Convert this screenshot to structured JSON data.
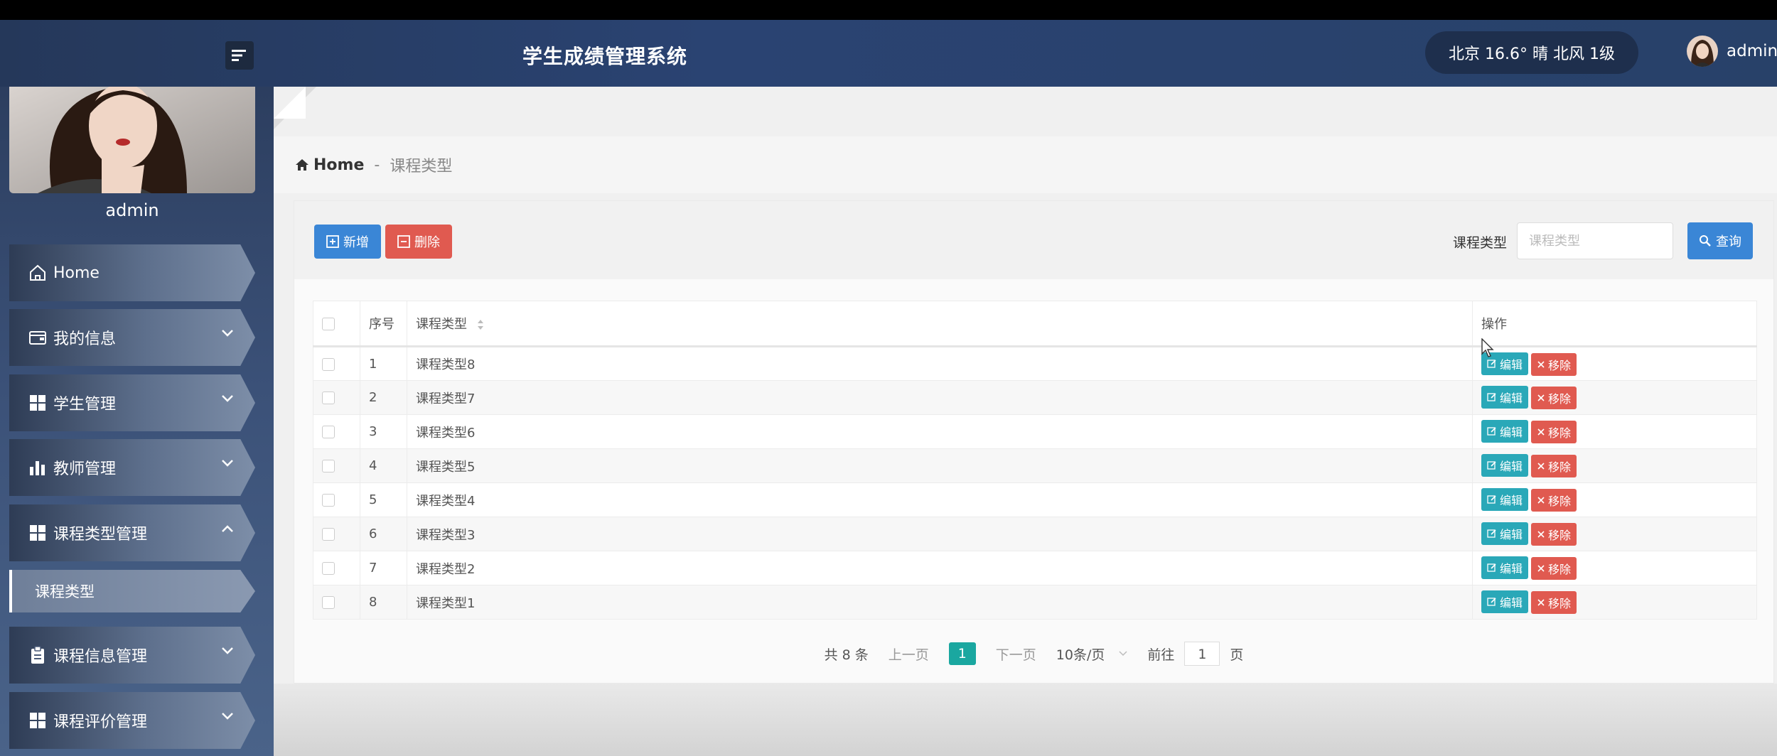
{
  "header": {
    "title": "学生成绩管理系统",
    "weather": "北京 16.6° 晴 北风 1级",
    "username": "admin"
  },
  "sidebar": {
    "profile_name": "admin",
    "items": [
      {
        "label": "Home",
        "icon": "home-icon"
      },
      {
        "label": "我的信息",
        "icon": "wallet-icon"
      },
      {
        "label": "学生管理",
        "icon": "grid-icon"
      },
      {
        "label": "教师管理",
        "icon": "bar-chart-icon"
      },
      {
        "label": "课程类型管理",
        "icon": "grid-icon"
      },
      {
        "label": "课程信息管理",
        "icon": "clipboard-icon"
      },
      {
        "label": "课程评价管理",
        "icon": "grid-icon"
      }
    ],
    "sub_item": "课程类型"
  },
  "breadcrumb": {
    "home": "Home",
    "sep": "-",
    "current": "课程类型"
  },
  "toolbar": {
    "add_label": "新增",
    "delete_label": "删除",
    "search_label": "课程类型",
    "search_placeholder": "课程类型",
    "query_label": "查询"
  },
  "table": {
    "headers": {
      "index": "序号",
      "type": "课程类型",
      "ops": "操作"
    },
    "rows": [
      {
        "index": "1",
        "type": "课程类型8"
      },
      {
        "index": "2",
        "type": "课程类型7"
      },
      {
        "index": "3",
        "type": "课程类型6"
      },
      {
        "index": "4",
        "type": "课程类型5"
      },
      {
        "index": "5",
        "type": "课程类型4"
      },
      {
        "index": "6",
        "type": "课程类型3"
      },
      {
        "index": "7",
        "type": "课程类型2"
      },
      {
        "index": "8",
        "type": "课程类型1"
      }
    ],
    "edit_label": "编辑",
    "remove_label": "移除"
  },
  "pager": {
    "total": "共 8 条",
    "prev": "上一页",
    "current": "1",
    "next": "下一页",
    "page_size": "10条/页",
    "goto": "前往",
    "goto_value": "1",
    "page_unit": "页"
  },
  "colors": {
    "accent_blue": "#3a86d6",
    "danger_red": "#e05a50",
    "teal": "#2aa8b8"
  }
}
